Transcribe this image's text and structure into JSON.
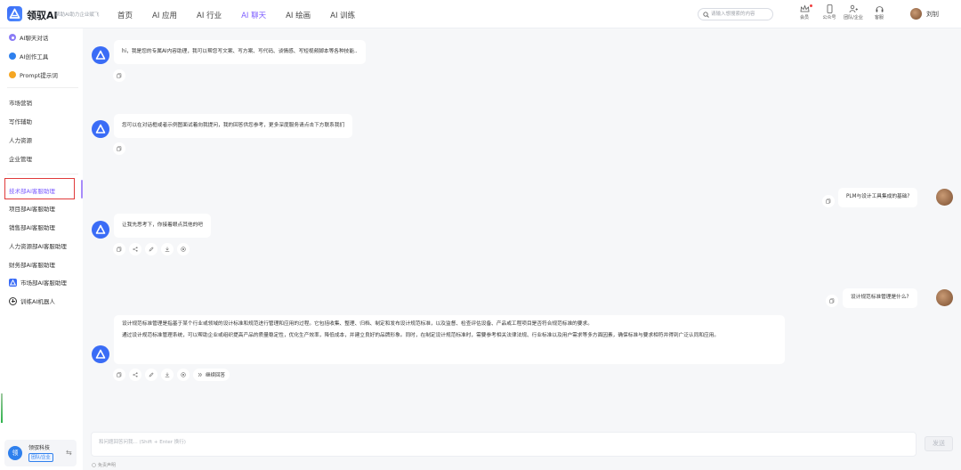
{
  "header": {
    "brand": "领驭AI",
    "slogan": "帮助AI助力企业赋飞",
    "nav": [
      {
        "label": "首页"
      },
      {
        "label": "AI 应用"
      },
      {
        "label": "AI 行业"
      },
      {
        "label": "AI 聊天"
      },
      {
        "label": "AI 绘画"
      },
      {
        "label": "AI 训练"
      }
    ],
    "active_nav": "AI 聊天",
    "search_placeholder": "请输入想搜索的内容",
    "tools": [
      {
        "label": "会员",
        "icon": "crown-icon"
      },
      {
        "label": "公众号",
        "icon": "phone-icon"
      },
      {
        "label": "团队/企业",
        "icon": "team-icon"
      },
      {
        "label": "客服",
        "icon": "headset-icon"
      }
    ],
    "user_name": "刘钊"
  },
  "sidebar": {
    "top_items": [
      {
        "label": "AI聊天对话",
        "icon": "chat-icon",
        "color": "#8b7cf6"
      },
      {
        "label": "AI创作工具",
        "icon": "create-icon",
        "color": "#2f80ed"
      },
      {
        "label": "Prompt提示词",
        "icon": "prompt-icon",
        "color": "#f5a623"
      }
    ],
    "group1": [
      {
        "label": "市场营销"
      },
      {
        "label": "写作辅助"
      },
      {
        "label": "人力资源"
      },
      {
        "label": "企业管理"
      }
    ],
    "group2": [
      {
        "label": "技术部AI客服助理"
      },
      {
        "label": "项目部AI客服助理"
      },
      {
        "label": "销售部AI客服助理"
      },
      {
        "label": "人力资源部AI客服助理"
      },
      {
        "label": "财务部AI客服助理"
      },
      {
        "label": "市场部AI客服助理"
      },
      {
        "label": "训练AI机器人"
      }
    ],
    "active_item": "技术部AI客服助理",
    "footer": {
      "avatar_text": "领",
      "org_name": "领驭科技",
      "tag": "团队/企业"
    }
  },
  "chat": {
    "messages": [
      {
        "role": "bot",
        "text": "hi，我是您的专属AI内容助理，我可以帮您写文案、写方案、写代码、谈情感、写短视频脚本等各种技能.."
      },
      {
        "role": "bot",
        "text": "您可以在对话框或者示例图面试着向我提问，我的回答供您参考，更多深度服务请点击下方联系我们"
      },
      {
        "role": "user",
        "text": "PLM与设计工具集成的基础?"
      },
      {
        "role": "bot",
        "text": "让我先思考下，你接着眼点其他的吧"
      },
      {
        "role": "user",
        "text": "设计规范标准管理是什么?"
      },
      {
        "role": "bot",
        "paragraphs": [
          "设计规范标准管理是指基于某个行业或领域的设计标准和规范进行管理和应用的过程。它包括收集、整理、归档、制定和发布设计规范标准，以及监督、检查评估设备、产品或工程项目是否符合规范标准的要求。",
          "通过设计规范标准管理系统，可以帮助企业或组织提高产品的质量稳定性，优化生产效率，降低成本，并建立良好的品牌形象。同时，在制定设计规范标准时，需要参考相关法律法规、行业标准以及用户需求等多方面因素，确保标准与要求相符并得到广泛认同和应用。"
        ]
      }
    ],
    "continue_label": "继续回答"
  },
  "input": {
    "placeholder": "和问题回答问我... (Shift + Enter 换行)",
    "send_label": "发送",
    "disclaimer": "免责声明"
  }
}
